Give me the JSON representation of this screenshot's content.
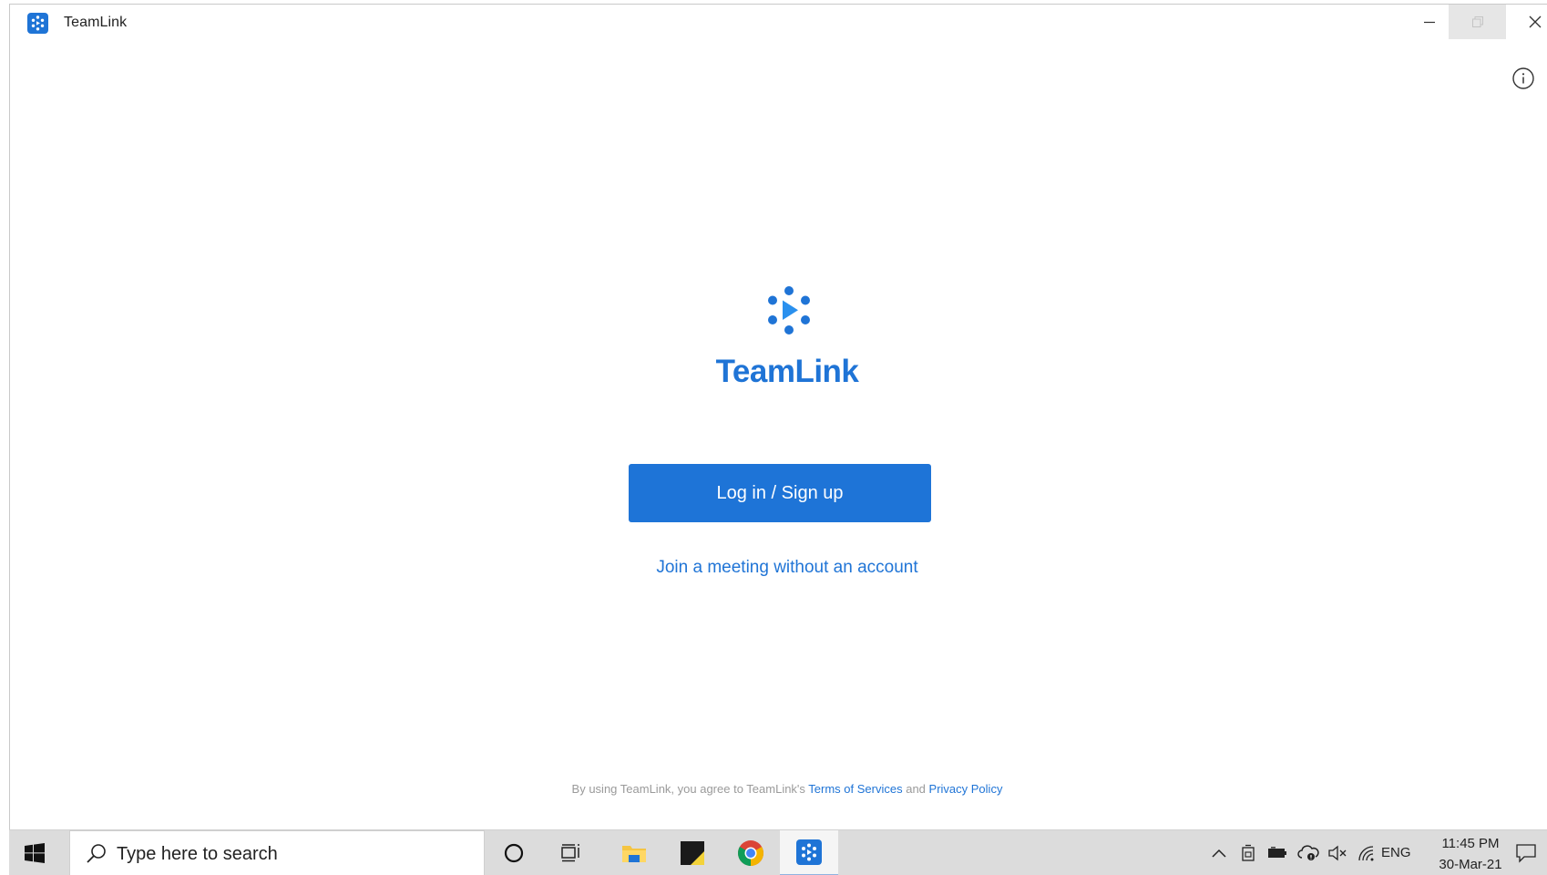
{
  "window": {
    "title": "TeamLink"
  },
  "main": {
    "brand_name": "TeamLink",
    "login_button": "Log in / Sign up",
    "join_link": "Join a meeting without an account",
    "terms": {
      "prefix": "By using TeamLink, you agree to TeamLink's ",
      "terms_link": "Terms of Services",
      "middle": " and ",
      "privacy_link": "Privacy Policy"
    }
  },
  "taskbar": {
    "search_placeholder": "Type here to search",
    "pinned": [
      "cortana-icon",
      "task-view-icon",
      "file-explorer-icon",
      "sticky-notes-icon",
      "chrome-icon",
      "teamlink-icon"
    ],
    "tray": {
      "language": "ENG",
      "time": "11:45 PM",
      "date": "30-Mar-21"
    }
  },
  "colors": {
    "brand": "#1f74d6",
    "taskbar": "#dcdcdc"
  }
}
